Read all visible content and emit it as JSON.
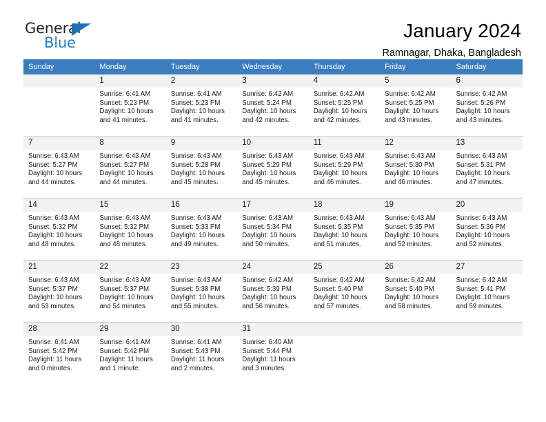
{
  "brand": {
    "name_part1": "General",
    "name_part2": "Blue",
    "logo_icon": "triangle-logo-icon"
  },
  "header": {
    "title": "January 2024",
    "subtitle": "Ramnagar, Dhaka, Bangladesh"
  },
  "calendar": {
    "weekday_headers": [
      "Sunday",
      "Monday",
      "Tuesday",
      "Wednesday",
      "Thursday",
      "Friday",
      "Saturday"
    ],
    "accent_color": "#3a7ebf",
    "daynum_band_color": "#f2f2f2",
    "weeks": [
      [
        {
          "day": "",
          "sunrise": "",
          "sunset": "",
          "daylight_a": "",
          "daylight_b": ""
        },
        {
          "day": "1",
          "sunrise": "Sunrise: 6:41 AM",
          "sunset": "Sunset: 5:23 PM",
          "daylight_a": "Daylight: 10 hours",
          "daylight_b": "and 41 minutes."
        },
        {
          "day": "2",
          "sunrise": "Sunrise: 6:41 AM",
          "sunset": "Sunset: 5:23 PM",
          "daylight_a": "Daylight: 10 hours",
          "daylight_b": "and 41 minutes."
        },
        {
          "day": "3",
          "sunrise": "Sunrise: 6:42 AM",
          "sunset": "Sunset: 5:24 PM",
          "daylight_a": "Daylight: 10 hours",
          "daylight_b": "and 42 minutes."
        },
        {
          "day": "4",
          "sunrise": "Sunrise: 6:42 AM",
          "sunset": "Sunset: 5:25 PM",
          "daylight_a": "Daylight: 10 hours",
          "daylight_b": "and 42 minutes."
        },
        {
          "day": "5",
          "sunrise": "Sunrise: 6:42 AM",
          "sunset": "Sunset: 5:25 PM",
          "daylight_a": "Daylight: 10 hours",
          "daylight_b": "and 43 minutes."
        },
        {
          "day": "6",
          "sunrise": "Sunrise: 6:42 AM",
          "sunset": "Sunset: 5:26 PM",
          "daylight_a": "Daylight: 10 hours",
          "daylight_b": "and 43 minutes."
        }
      ],
      [
        {
          "day": "7",
          "sunrise": "Sunrise: 6:43 AM",
          "sunset": "Sunset: 5:27 PM",
          "daylight_a": "Daylight: 10 hours",
          "daylight_b": "and 44 minutes."
        },
        {
          "day": "8",
          "sunrise": "Sunrise: 6:43 AM",
          "sunset": "Sunset: 5:27 PM",
          "daylight_a": "Daylight: 10 hours",
          "daylight_b": "and 44 minutes."
        },
        {
          "day": "9",
          "sunrise": "Sunrise: 6:43 AM",
          "sunset": "Sunset: 5:28 PM",
          "daylight_a": "Daylight: 10 hours",
          "daylight_b": "and 45 minutes."
        },
        {
          "day": "10",
          "sunrise": "Sunrise: 6:43 AM",
          "sunset": "Sunset: 5:29 PM",
          "daylight_a": "Daylight: 10 hours",
          "daylight_b": "and 45 minutes."
        },
        {
          "day": "11",
          "sunrise": "Sunrise: 6:43 AM",
          "sunset": "Sunset: 5:29 PM",
          "daylight_a": "Daylight: 10 hours",
          "daylight_b": "and 46 minutes."
        },
        {
          "day": "12",
          "sunrise": "Sunrise: 6:43 AM",
          "sunset": "Sunset: 5:30 PM",
          "daylight_a": "Daylight: 10 hours",
          "daylight_b": "and 46 minutes."
        },
        {
          "day": "13",
          "sunrise": "Sunrise: 6:43 AM",
          "sunset": "Sunset: 5:31 PM",
          "daylight_a": "Daylight: 10 hours",
          "daylight_b": "and 47 minutes."
        }
      ],
      [
        {
          "day": "14",
          "sunrise": "Sunrise: 6:43 AM",
          "sunset": "Sunset: 5:32 PM",
          "daylight_a": "Daylight: 10 hours",
          "daylight_b": "and 48 minutes."
        },
        {
          "day": "15",
          "sunrise": "Sunrise: 6:43 AM",
          "sunset": "Sunset: 5:32 PM",
          "daylight_a": "Daylight: 10 hours",
          "daylight_b": "and 48 minutes."
        },
        {
          "day": "16",
          "sunrise": "Sunrise: 6:43 AM",
          "sunset": "Sunset: 5:33 PM",
          "daylight_a": "Daylight: 10 hours",
          "daylight_b": "and 49 minutes."
        },
        {
          "day": "17",
          "sunrise": "Sunrise: 6:43 AM",
          "sunset": "Sunset: 5:34 PM",
          "daylight_a": "Daylight: 10 hours",
          "daylight_b": "and 50 minutes."
        },
        {
          "day": "18",
          "sunrise": "Sunrise: 6:43 AM",
          "sunset": "Sunset: 5:35 PM",
          "daylight_a": "Daylight: 10 hours",
          "daylight_b": "and 51 minutes."
        },
        {
          "day": "19",
          "sunrise": "Sunrise: 6:43 AM",
          "sunset": "Sunset: 5:35 PM",
          "daylight_a": "Daylight: 10 hours",
          "daylight_b": "and 52 minutes."
        },
        {
          "day": "20",
          "sunrise": "Sunrise: 6:43 AM",
          "sunset": "Sunset: 5:36 PM",
          "daylight_a": "Daylight: 10 hours",
          "daylight_b": "and 52 minutes."
        }
      ],
      [
        {
          "day": "21",
          "sunrise": "Sunrise: 6:43 AM",
          "sunset": "Sunset: 5:37 PM",
          "daylight_a": "Daylight: 10 hours",
          "daylight_b": "and 53 minutes."
        },
        {
          "day": "22",
          "sunrise": "Sunrise: 6:43 AM",
          "sunset": "Sunset: 5:37 PM",
          "daylight_a": "Daylight: 10 hours",
          "daylight_b": "and 54 minutes."
        },
        {
          "day": "23",
          "sunrise": "Sunrise: 6:43 AM",
          "sunset": "Sunset: 5:38 PM",
          "daylight_a": "Daylight: 10 hours",
          "daylight_b": "and 55 minutes."
        },
        {
          "day": "24",
          "sunrise": "Sunrise: 6:42 AM",
          "sunset": "Sunset: 5:39 PM",
          "daylight_a": "Daylight: 10 hours",
          "daylight_b": "and 56 minutes."
        },
        {
          "day": "25",
          "sunrise": "Sunrise: 6:42 AM",
          "sunset": "Sunset: 5:40 PM",
          "daylight_a": "Daylight: 10 hours",
          "daylight_b": "and 57 minutes."
        },
        {
          "day": "26",
          "sunrise": "Sunrise: 6:42 AM",
          "sunset": "Sunset: 5:40 PM",
          "daylight_a": "Daylight: 10 hours",
          "daylight_b": "and 58 minutes."
        },
        {
          "day": "27",
          "sunrise": "Sunrise: 6:42 AM",
          "sunset": "Sunset: 5:41 PM",
          "daylight_a": "Daylight: 10 hours",
          "daylight_b": "and 59 minutes."
        }
      ],
      [
        {
          "day": "28",
          "sunrise": "Sunrise: 6:41 AM",
          "sunset": "Sunset: 5:42 PM",
          "daylight_a": "Daylight: 11 hours",
          "daylight_b": "and 0 minutes."
        },
        {
          "day": "29",
          "sunrise": "Sunrise: 6:41 AM",
          "sunset": "Sunset: 5:42 PM",
          "daylight_a": "Daylight: 11 hours",
          "daylight_b": "and 1 minute."
        },
        {
          "day": "30",
          "sunrise": "Sunrise: 6:41 AM",
          "sunset": "Sunset: 5:43 PM",
          "daylight_a": "Daylight: 11 hours",
          "daylight_b": "and 2 minutes."
        },
        {
          "day": "31",
          "sunrise": "Sunrise: 6:40 AM",
          "sunset": "Sunset: 5:44 PM",
          "daylight_a": "Daylight: 11 hours",
          "daylight_b": "and 3 minutes."
        },
        {
          "day": "",
          "sunrise": "",
          "sunset": "",
          "daylight_a": "",
          "daylight_b": ""
        },
        {
          "day": "",
          "sunrise": "",
          "sunset": "",
          "daylight_a": "",
          "daylight_b": ""
        },
        {
          "day": "",
          "sunrise": "",
          "sunset": "",
          "daylight_a": "",
          "daylight_b": ""
        }
      ]
    ]
  }
}
